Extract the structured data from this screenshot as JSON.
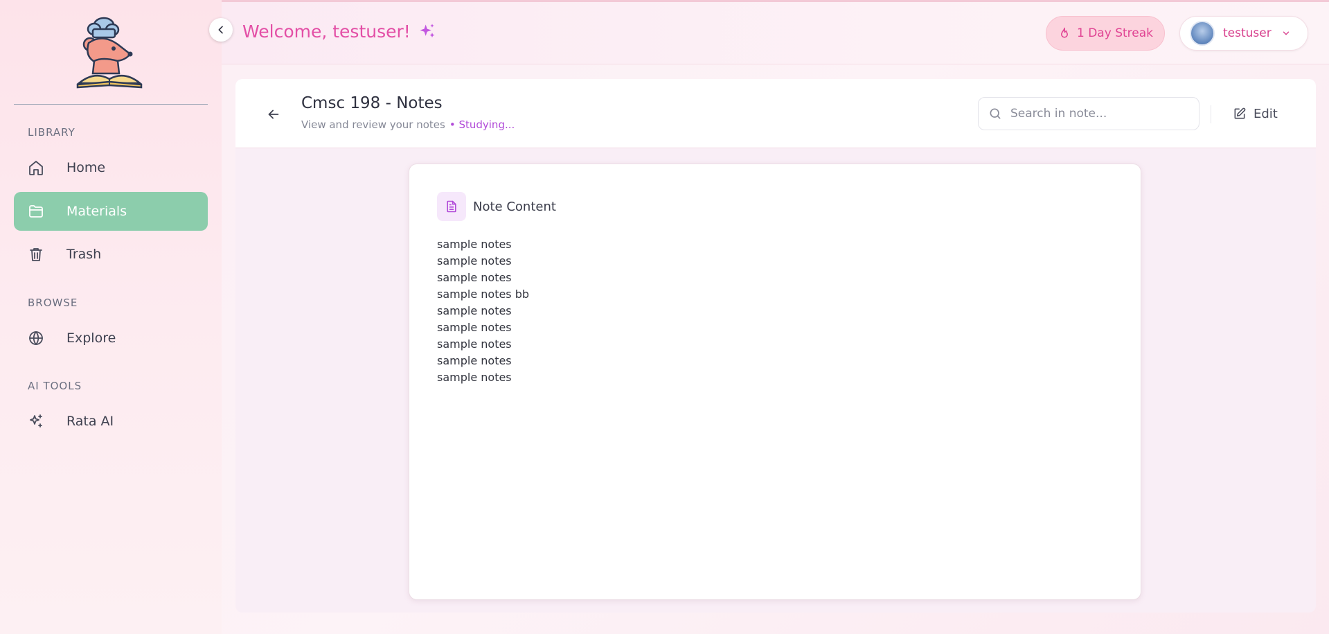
{
  "header": {
    "welcome": "Welcome, testuser!",
    "streak_label": "1 Day Streak",
    "username": "testuser"
  },
  "sidebar": {
    "sections": [
      {
        "label": "LIBRARY",
        "items": [
          {
            "label": "Home",
            "icon": "home-icon"
          },
          {
            "label": "Materials",
            "icon": "folder-icon",
            "active": true
          },
          {
            "label": "Trash",
            "icon": "trash-icon"
          }
        ]
      },
      {
        "label": "BROWSE",
        "items": [
          {
            "label": "Explore",
            "icon": "globe-icon"
          }
        ]
      },
      {
        "label": "AI TOOLS",
        "items": [
          {
            "label": "Rata AI",
            "icon": "sparkles-icon"
          }
        ]
      }
    ]
  },
  "note": {
    "title": "Cmsc 198 - Notes",
    "subtitle": "View and review your notes",
    "status": "• Studying...",
    "search_placeholder": "Search in note...",
    "edit_label": "Edit",
    "content_title": "Note Content",
    "lines": [
      "sample notes",
      "sample notes",
      "sample notes",
      "sample notes bb",
      "sample notes",
      "sample notes",
      "sample notes",
      "sample notes",
      "sample notes"
    ]
  },
  "colors": {
    "accent_pink": "#e34fa6",
    "active_nav": "#8ccdac",
    "status_purple": "#b14ad8"
  }
}
